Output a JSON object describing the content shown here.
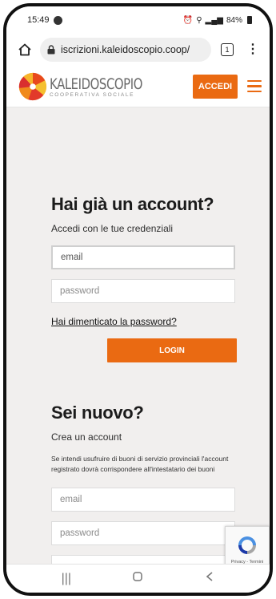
{
  "status_bar": {
    "time": "15:49",
    "right_text": "84%"
  },
  "browser": {
    "url": "iscrizioni.kaleidoscopio.coop/",
    "tab_count": "1"
  },
  "header": {
    "logo_name": "KALEIDOSCOPIO",
    "logo_subtitle": "COOPERATIVA SOCIALE",
    "accedi_label": "ACCEDI",
    "accent_color": "#ea6a12"
  },
  "login": {
    "title": "Hai già un account?",
    "subtitle": "Accedi con le tue credenziali",
    "email_placeholder": "email",
    "password_placeholder": "password",
    "forgot_label": "Hai dimenticato la password?",
    "login_label": "LOGIN"
  },
  "register": {
    "title": "Sei nuovo?",
    "subtitle": "Crea un account",
    "info": "Se intendi usufruire di buoni di servizio provinciali l'account registrato dovrà corrispondere all'intestatario dei buoni",
    "email_placeholder": "email",
    "password_placeholder": "password"
  },
  "recaptcha": {
    "label": "Privacy - Termini"
  },
  "navbar": {
    "items": [
      "recent-apps",
      "home",
      "back"
    ]
  }
}
